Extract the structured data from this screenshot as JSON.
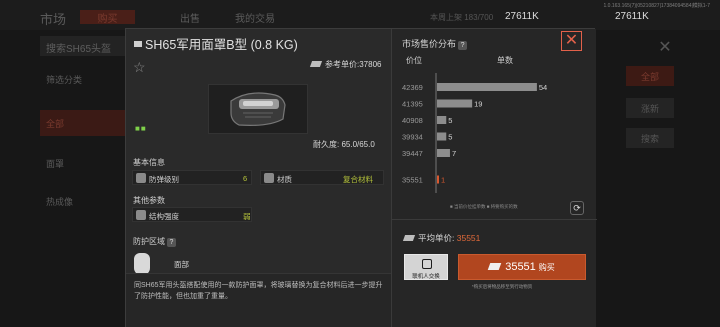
{
  "background": {
    "title": "市场",
    "tabs": [
      "购买",
      "出售",
      "我的交易"
    ],
    "status_text": "本周上架 183/700",
    "money_left": "27611K",
    "money_right": "27611K",
    "version": "1.0.163.165(7)|05210827|17384094584|模拟1-7",
    "search_placeholder": "搜索SH65头盔",
    "categories": [
      "筛选分类",
      "全部",
      "面罩",
      "热成像"
    ],
    "right_buttons": [
      "全部",
      "涨新",
      "搜索"
    ]
  },
  "item": {
    "title": "SH65军用面罩B型 (0.8 KG)",
    "ref_price_label": "参考单价:37806",
    "durability": "耐久度: 65.0/65.0",
    "basic_info_head": "基本信息",
    "protection_label": "防弹级别",
    "protection_value": "6",
    "material_label": "材质",
    "material_value": "复合材料",
    "other_params_head": "其他参数",
    "structure_label": "结构强度",
    "structure_value": "弱",
    "protect_area_head": "防护区域",
    "protect_area_help": "?",
    "protect_area_value": "面部",
    "description": "同SH65军用头盔搭配使用的一款防护面罩，将玻璃替换为复合材料后进一步提升了防护性能，但也加重了重量。"
  },
  "market": {
    "title": "市场售价分布",
    "help": "?",
    "col_price": "价位",
    "col_count": "单数",
    "legend": "■ 当前价位挂单数    ■ 将要购买的数",
    "avg_label": "平均单价:",
    "avg_value": "35551",
    "exchange_label": "联机人交换",
    "buy_price": "35551",
    "buy_label": "购买",
    "note": "*购买后将物品移至到行动物资"
  },
  "chart_data": {
    "type": "bar",
    "orientation": "horizontal",
    "categories": [
      "42369",
      "41395",
      "40908",
      "39934",
      "39447",
      "35551"
    ],
    "series": [
      {
        "values": [
          54,
          19,
          5,
          5,
          7,
          1
        ]
      }
    ],
    "highlight_category": "35551",
    "highlight_color": "#d9582f",
    "bar_color": "#8d8d8d",
    "xlim": [
      0,
      60
    ],
    "xlabel": "单数",
    "ylabel": "价位"
  },
  "colors": {
    "accent": "#b1461f",
    "highlight_value": "#b7c53b",
    "price": "#e26a3a"
  }
}
